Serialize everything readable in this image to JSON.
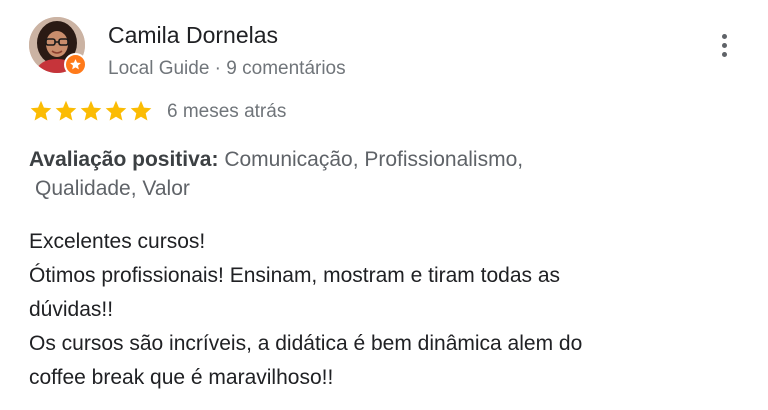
{
  "reviewer": {
    "name": "Camila Dornelas",
    "meta": "Local Guide · 9 comentários"
  },
  "rating": {
    "stars": 5,
    "max_stars": 5,
    "time_ago": "6 meses atrás"
  },
  "highlights": {
    "label": "Avaliação positiva:",
    "line1": "Comunicação, Profissionalismo,",
    "line2": "Qualidade, Valor"
  },
  "review_lines": [
    "Excelentes cursos!",
    "Ótimos profissionais! Ensinam, mostram e tiram todas as",
    "dúvidas!!",
    "Os cursos são incríveis, a didática é bem dinâmica alem do",
    "coffee break que é maravilhoso!!"
  ],
  "colors": {
    "star": "#fbbc04",
    "badge": "#ff7a1a",
    "meta_text": "#70757a"
  },
  "icons": {
    "more": "more-vert-icon",
    "star": "star-icon",
    "badge": "local-guide-badge-icon"
  }
}
